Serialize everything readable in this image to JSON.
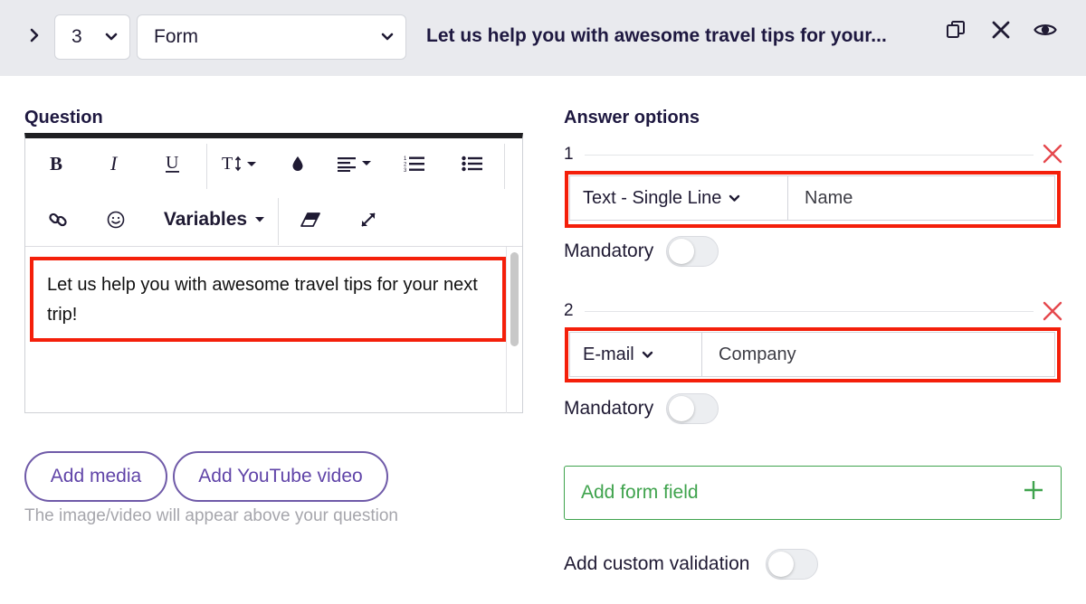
{
  "header": {
    "step_number": "3",
    "question_type": "Form",
    "title": "Let us help you with awesome travel tips for your..."
  },
  "question": {
    "heading": "Question",
    "variables_label": "Variables",
    "text": "Let us help you with awesome travel tips for your next trip!"
  },
  "media": {
    "add_media_label": "Add media",
    "add_youtube_label": "Add YouTube video",
    "hint": "The image/video will appear above your question"
  },
  "answers": {
    "heading": "Answer options",
    "options": [
      {
        "number": "1",
        "type": "Text - Single Line",
        "value": "Name",
        "mandatory_label": "Mandatory",
        "mandatory": false
      },
      {
        "number": "2",
        "type": "E-mail",
        "value": "Company",
        "mandatory_label": "Mandatory",
        "mandatory": false
      }
    ],
    "add_field_label": "Add form field",
    "custom_validation_label": "Add custom validation",
    "custom_validation": false
  },
  "colors": {
    "accent_purple": "#6044a8",
    "add_green": "#3fa34d",
    "remove_red": "#e5484d",
    "highlight_red": "#f41f0a"
  }
}
